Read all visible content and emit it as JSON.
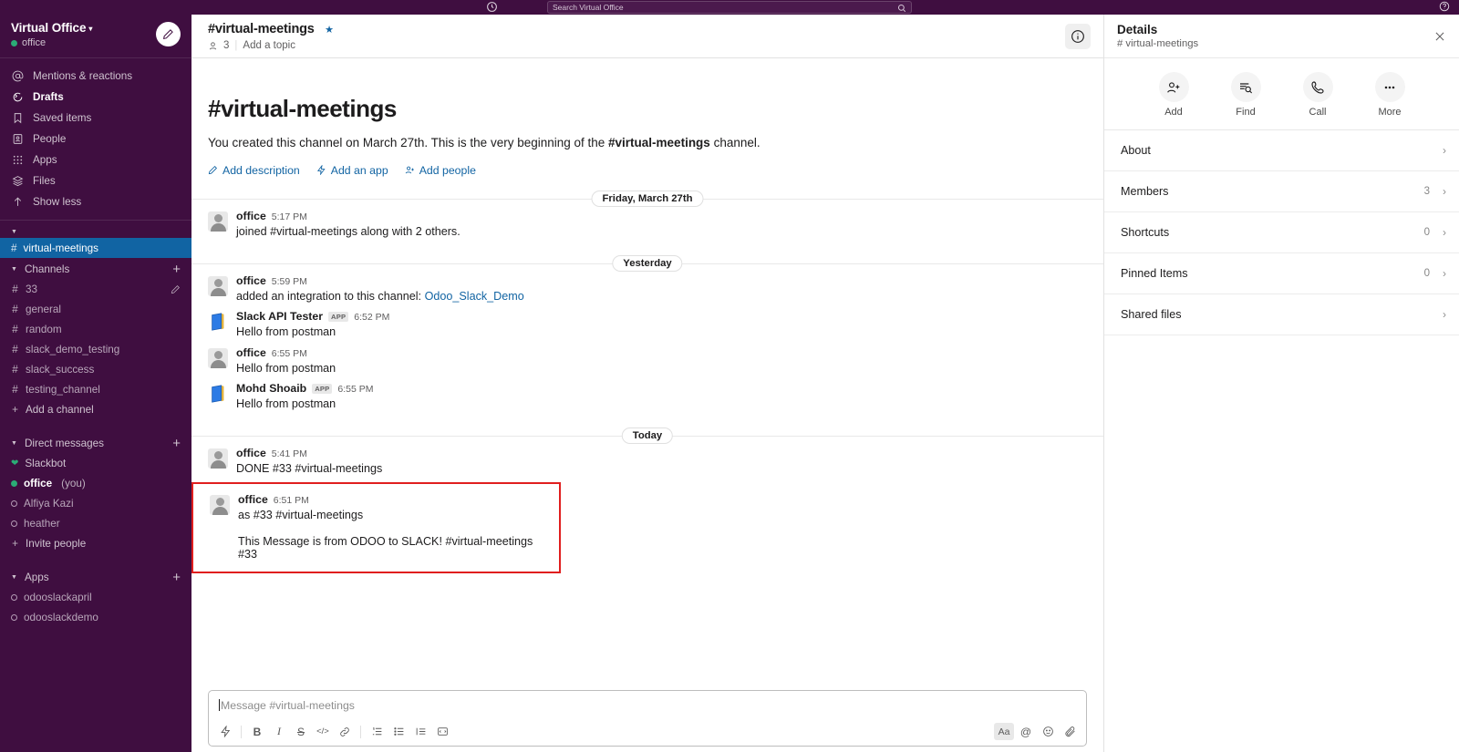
{
  "topbar": {
    "history_icon": "clock-icon",
    "search_placeholder": "Search Virtual Office",
    "search_value": "",
    "search_icon": "search-icon",
    "help_icon": "help-icon"
  },
  "sidebar": {
    "workspace_name": "Virtual Office",
    "workspace_caret": "⌄",
    "user_name": "office",
    "compose_icon": "compose-icon",
    "nav": [
      {
        "label": "Mentions & reactions",
        "icon": "at-icon",
        "bold": false
      },
      {
        "label": "Drafts",
        "icon": "drafts-icon",
        "bold": true
      },
      {
        "label": "Saved items",
        "icon": "bookmark-icon",
        "bold": false
      },
      {
        "label": "People",
        "icon": "people-icon",
        "bold": false
      },
      {
        "label": "Apps",
        "icon": "apps-grid-icon",
        "bold": false
      },
      {
        "label": "Files",
        "icon": "files-icon",
        "bold": false
      },
      {
        "label": "Show less",
        "icon": "arrow-up-icon",
        "bold": false
      }
    ],
    "selected_channel": "virtual-meetings",
    "channels_section": {
      "title": "Channels",
      "add_icon": "plus-icon",
      "items": [
        {
          "label": "33",
          "prefix": "#",
          "trailing": "pencil-icon"
        },
        {
          "label": "general",
          "prefix": "#",
          "trailing": ""
        },
        {
          "label": "random",
          "prefix": "#",
          "trailing": ""
        },
        {
          "label": "slack_demo_testing",
          "prefix": "#",
          "trailing": ""
        },
        {
          "label": "slack_success",
          "prefix": "#",
          "trailing": ""
        },
        {
          "label": "testing_channel",
          "prefix": "#",
          "trailing": ""
        },
        {
          "label": "Add a channel",
          "prefix": "+",
          "trailing": ""
        }
      ]
    },
    "dm_section": {
      "title": "Direct messages",
      "add_icon": "plus-icon",
      "items": [
        {
          "label": "Slackbot",
          "status": "heart",
          "suffix": ""
        },
        {
          "label": "office",
          "status": "online",
          "suffix": "(you)"
        },
        {
          "label": "Alfiya Kazi",
          "status": "offline",
          "suffix": ""
        },
        {
          "label": "heather",
          "status": "offline",
          "suffix": ""
        },
        {
          "label": "Invite people",
          "status": "plus",
          "suffix": ""
        }
      ]
    },
    "apps_section": {
      "title": "Apps",
      "add_icon": "plus-icon",
      "items": [
        {
          "label": "odooslackapril",
          "status": "offline"
        },
        {
          "label": "odooslackdemo",
          "status": "offline"
        }
      ]
    }
  },
  "channel_header": {
    "title": "#virtual-meetings",
    "starred_icon": "star-icon",
    "members_icon": "member-icon",
    "member_count": "3",
    "topic_placeholder": "Add a topic",
    "info_icon": "info-icon"
  },
  "intro": {
    "heading": "#virtual-meetings",
    "text_before": "You created this channel on March 27th. This is the very beginning of the ",
    "text_bold": "#virtual-meetings",
    "text_after": " channel.",
    "actions": [
      {
        "label": "Add description",
        "icon": "pencil-icon"
      },
      {
        "label": "Add an app",
        "icon": "lightning-icon"
      },
      {
        "label": "Add people",
        "icon": "add-person-icon"
      }
    ]
  },
  "messages": {
    "dividers": {
      "d1": "Friday, March 27th",
      "d2": "Yesterday",
      "d3": "Today"
    },
    "group1": [
      {
        "author": "office",
        "time": "5:17 PM",
        "badge": "",
        "avatar": "user-avatar",
        "text": "joined #virtual-meetings along with 2 others."
      }
    ],
    "group2": [
      {
        "author": "office",
        "time": "5:59 PM",
        "badge": "",
        "avatar": "user-avatar",
        "text_before": "added an integration to this channel: ",
        "link": "Odoo_Slack_Demo"
      },
      {
        "author": "Slack API Tester",
        "time": "6:52 PM",
        "badge": "APP",
        "avatar": "app-avatar",
        "text": "Hello from postman"
      },
      {
        "author": "office",
        "time": "6:55 PM",
        "badge": "",
        "avatar": "user-avatar",
        "text": "Hello from postman"
      },
      {
        "author": "Mohd Shoaib",
        "time": "6:55 PM",
        "badge": "APP",
        "avatar": "app-avatar",
        "text": "Hello from postman"
      }
    ],
    "group3": [
      {
        "author": "office",
        "time": "5:41 PM",
        "badge": "",
        "avatar": "user-avatar",
        "text": "DONE #33 #virtual-meetings"
      }
    ],
    "highlighted": {
      "author": "office",
      "time": "6:51 PM",
      "badge": "",
      "avatar": "user-avatar",
      "text": "as #33 #virtual-meetings",
      "attachment_text": "This Message is from ODOO to SLACK! #virtual-meetings #33",
      "highlight_color": "#E01E1E"
    }
  },
  "composer": {
    "placeholder": "Message #virtual-meetings",
    "value": "",
    "left_tools": [
      {
        "name": "shortcuts-lightning-icon",
        "glyph": "⚡",
        "active": false
      },
      {
        "name": "bold-icon",
        "glyph": "B",
        "active": false
      },
      {
        "name": "italic-icon",
        "glyph": "I",
        "active": false
      },
      {
        "name": "strikethrough-icon",
        "glyph": "S",
        "active": false
      },
      {
        "name": "code-icon",
        "glyph": "</>",
        "active": false
      },
      {
        "name": "link-icon",
        "glyph": "🔗",
        "active": false
      },
      {
        "name": "ordered-list-icon",
        "glyph": "1≡",
        "active": false
      },
      {
        "name": "bulleted-list-icon",
        "glyph": "•≡",
        "active": false
      },
      {
        "name": "blockquote-icon",
        "glyph": "”≡",
        "active": false
      },
      {
        "name": "code-block-icon",
        "glyph": "⌨",
        "active": false
      }
    ],
    "right_tools": [
      {
        "name": "formatting-aa-icon",
        "glyph": "Aa",
        "active": true
      },
      {
        "name": "mention-icon",
        "glyph": "@",
        "active": false
      },
      {
        "name": "emoji-icon",
        "glyph": "☺",
        "active": false
      },
      {
        "name": "attachment-icon",
        "glyph": "📎",
        "active": false
      }
    ]
  },
  "details": {
    "title": "Details",
    "subtitle": "# virtual-meetings",
    "close_icon": "close-icon",
    "quick_actions": [
      {
        "label": "Add",
        "icon": "add-person-icon"
      },
      {
        "label": "Find",
        "icon": "find-icon"
      },
      {
        "label": "Call",
        "icon": "phone-icon"
      },
      {
        "label": "More",
        "icon": "more-dots-icon"
      }
    ],
    "rows": [
      {
        "label": "About",
        "count": ""
      },
      {
        "label": "Members",
        "count": "3"
      },
      {
        "label": "Shortcuts",
        "count": "0"
      },
      {
        "label": "Pinned Items",
        "count": "0"
      },
      {
        "label": "Shared files",
        "count": ""
      }
    ]
  },
  "colors": {
    "sidebar_bg": "#3F0E40",
    "selected_channel": "#1164A3",
    "link": "#1264A3",
    "highlight": "#E01E1E",
    "online": "#2BAC76"
  }
}
